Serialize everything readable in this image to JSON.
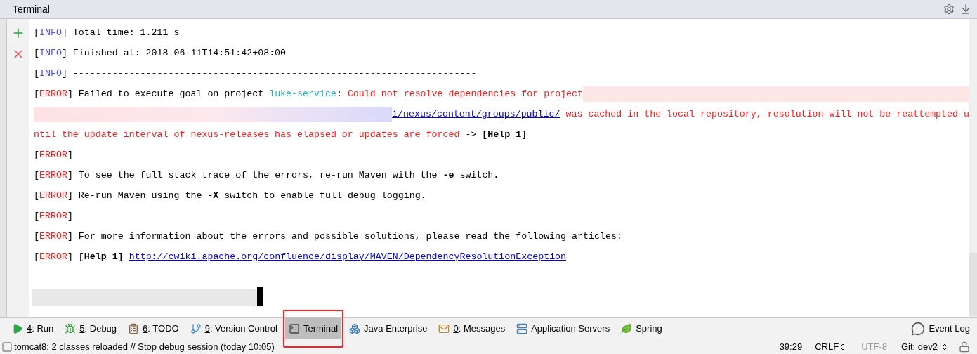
{
  "panel": {
    "title": "Terminal"
  },
  "console": [
    {
      "segments": [
        {
          "kind": "plain",
          "text": "["
        },
        {
          "kind": "info",
          "text": "INFO"
        },
        {
          "kind": "plain",
          "text": "] Total time: 1.211 s"
        }
      ]
    },
    {
      "segments": [
        {
          "kind": "plain",
          "text": "["
        },
        {
          "kind": "info",
          "text": "INFO"
        },
        {
          "kind": "plain",
          "text": "] Finished at: 2018-06-11T14:51:42+08:00"
        }
      ]
    },
    {
      "segments": [
        {
          "kind": "plain",
          "text": "["
        },
        {
          "kind": "info",
          "text": "INFO"
        },
        {
          "kind": "plain",
          "text": "] ------------------------------------------------------------------------"
        }
      ]
    },
    {
      "segments": [
        {
          "kind": "plain",
          "text": "["
        },
        {
          "kind": "error",
          "text": "ERROR"
        },
        {
          "kind": "plain",
          "text": "] Failed to execute goal on project "
        },
        {
          "kind": "project",
          "text": "luke-service"
        },
        {
          "kind": "plain",
          "text": ": "
        },
        {
          "kind": "error",
          "text": "Could not resolve dependencies for project"
        },
        {
          "kind": "redacted_fill"
        }
      ]
    },
    {
      "segments": [
        {
          "kind": "redacted"
        },
        {
          "kind": "link",
          "text": "1/nexus/content/groups/public/"
        },
        {
          "kind": "error",
          "text": " was cached in the local repository, resolution will not be reattempted u"
        }
      ]
    },
    {
      "segments": [
        {
          "kind": "error",
          "text": "ntil the update interval of nexus-releases has elapsed or updates are forced"
        },
        {
          "kind": "plain",
          "text": " -> "
        },
        {
          "kind": "bold",
          "text": "[Help 1]"
        }
      ]
    },
    {
      "segments": [
        {
          "kind": "plain",
          "text": "["
        },
        {
          "kind": "error",
          "text": "ERROR"
        },
        {
          "kind": "plain",
          "text": "]"
        }
      ]
    },
    {
      "segments": [
        {
          "kind": "plain",
          "text": "["
        },
        {
          "kind": "error",
          "text": "ERROR"
        },
        {
          "kind": "plain",
          "text": "] To see the full stack trace of the errors, re-run Maven with the "
        },
        {
          "kind": "bold",
          "text": "-e"
        },
        {
          "kind": "plain",
          "text": " switch."
        }
      ]
    },
    {
      "segments": [
        {
          "kind": "plain",
          "text": "["
        },
        {
          "kind": "error",
          "text": "ERROR"
        },
        {
          "kind": "plain",
          "text": "] Re-run Maven using the "
        },
        {
          "kind": "bold",
          "text": "-X"
        },
        {
          "kind": "plain",
          "text": " switch to enable full debug logging."
        }
      ]
    },
    {
      "segments": [
        {
          "kind": "plain",
          "text": "["
        },
        {
          "kind": "error",
          "text": "ERROR"
        },
        {
          "kind": "plain",
          "text": "]"
        }
      ]
    },
    {
      "segments": [
        {
          "kind": "plain",
          "text": "["
        },
        {
          "kind": "error",
          "text": "ERROR"
        },
        {
          "kind": "plain",
          "text": "] For more information about the errors and possible solutions, please read the following articles:"
        }
      ]
    },
    {
      "segments": [
        {
          "kind": "plain",
          "text": "["
        },
        {
          "kind": "error",
          "text": "ERROR"
        },
        {
          "kind": "plain",
          "text": "] "
        },
        {
          "kind": "bold",
          "text": "[Help 1] "
        },
        {
          "kind": "link",
          "text": "http://cwiki.apache.org/confluence/display/MAVEN/DependencyResolutionException"
        }
      ]
    }
  ],
  "prompt": {
    "redacted": true,
    "cursor": true
  },
  "tool_tabs": [
    {
      "kind": "run",
      "mnemonic": "4",
      "label": ": Run",
      "selected": false,
      "annotated": false
    },
    {
      "kind": "debug",
      "mnemonic": "5",
      "label": ": Debug",
      "selected": false,
      "annotated": false
    },
    {
      "kind": "todo",
      "mnemonic": "6",
      "label": ": TODO",
      "selected": false,
      "annotated": false
    },
    {
      "kind": "vcs",
      "mnemonic": "9",
      "label": ": Version Control",
      "selected": false,
      "annotated": false
    },
    {
      "kind": "terminal",
      "label": "Terminal",
      "selected": true,
      "annotated": true
    },
    {
      "kind": "javaee",
      "label": "Java Enterprise",
      "selected": false,
      "annotated": false
    },
    {
      "kind": "messages",
      "mnemonic": "0",
      "label": ": Messages",
      "selected": false,
      "annotated": false
    },
    {
      "kind": "servers",
      "label": "Application Servers",
      "selected": false,
      "annotated": false
    },
    {
      "kind": "spring",
      "label": "Spring",
      "selected": false,
      "annotated": false
    }
  ],
  "event_log": {
    "label": "Event Log"
  },
  "status_bar": {
    "message": "tomcat8: 2 classes reloaded // Stop debug session (today 10:05)",
    "position": "39:29",
    "line_separator": "CRLF",
    "encoding": "UTF-8",
    "encoding_disabled": true,
    "vcs_branch": "Git: dev2"
  }
}
